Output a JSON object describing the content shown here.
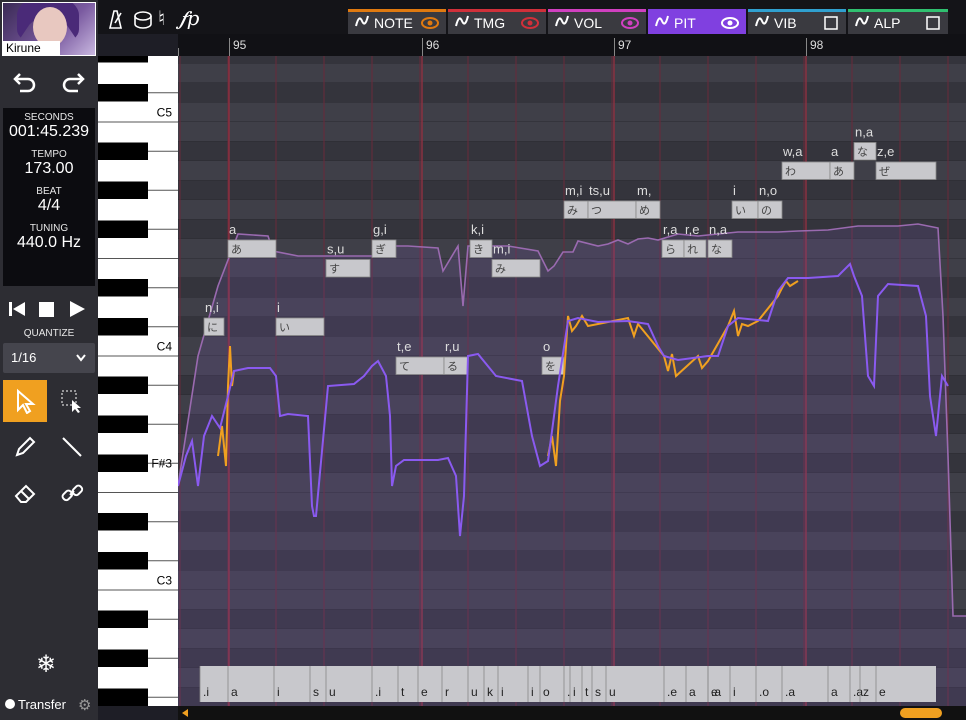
{
  "singer": {
    "name": "Kirune"
  },
  "info": {
    "seconds_label": "SECONDS",
    "seconds": "001:45.239",
    "tempo_label": "TEMPO",
    "tempo": "173.00",
    "beat_label": "BEAT",
    "beat": "4/4",
    "tuning_label": "TUNING",
    "tuning": "440.0 Hz"
  },
  "quantize": {
    "label": "QUANTIZE",
    "value": "1/16"
  },
  "transfer_label": "Transfer",
  "tabs": [
    {
      "label": "NOTE",
      "color": "#e07a10",
      "icon": "note-icon",
      "state": "eye"
    },
    {
      "label": "TMG",
      "color": "#d0303a",
      "icon": "timing-icon",
      "state": "eye"
    },
    {
      "label": "VOL",
      "color": "#d040c0",
      "icon": "volume-icon",
      "state": "eye"
    },
    {
      "label": "PIT",
      "color": "#8040e0",
      "icon": "pitch-icon",
      "state": "eye",
      "active": true
    },
    {
      "label": "VIB",
      "color": "#30a0d0",
      "icon": "vibrato-icon",
      "state": "box"
    },
    {
      "label": "ALP",
      "color": "#30c070",
      "icon": "alpha-icon",
      "state": "box"
    }
  ],
  "measures": [
    "95",
    "96",
    "97",
    "98"
  ],
  "key_labels": [
    "C5",
    "C4",
    "F#3",
    "C3"
  ],
  "notes": [
    {
      "phon": "n,i",
      "kana": "に"
    },
    {
      "phon": "a",
      "kana": "あ"
    },
    {
      "phon": "i",
      "kana": "い"
    },
    {
      "phon": "s,u",
      "kana": "す"
    },
    {
      "phon": "g,i",
      "kana": "ぎ"
    },
    {
      "phon": "t,e",
      "kana": "て"
    },
    {
      "phon": "r,u",
      "kana": "る"
    },
    {
      "phon": "k,i",
      "kana": "き"
    },
    {
      "phon": "m,i",
      "kana": "み"
    },
    {
      "phon": "o",
      "kana": "を"
    },
    {
      "phon": "m,i",
      "kana": "み"
    },
    {
      "phon": "ts,u",
      "kana": "つ"
    },
    {
      "phon": "m,",
      "kana": "め"
    },
    {
      "phon": "r,a",
      "kana": "ら"
    },
    {
      "phon": "r,e",
      "kana": "れ"
    },
    {
      "phon": "n,a",
      "kana": "な"
    },
    {
      "phon": "i",
      "kana": "い"
    },
    {
      "phon": "n,o",
      "kana": "の"
    },
    {
      "phon": "w,a",
      "kana": "わ"
    },
    {
      "phon": "a",
      "kana": "あ"
    },
    {
      "phon": "n,a",
      "kana": "な"
    },
    {
      "phon": "z,e",
      "kana": "ぜ"
    }
  ],
  "lyric_bar": [
    ".i",
    "a",
    "i",
    "s",
    "u",
    ".i",
    "t",
    "e",
    "r",
    "u",
    "k",
    "i",
    "i",
    "o",
    ".",
    "i",
    "t",
    "s",
    "u",
    ".e",
    "a",
    "e",
    ".a",
    "i",
    ".o",
    ".a",
    "a",
    ".a",
    "z",
    "e"
  ]
}
